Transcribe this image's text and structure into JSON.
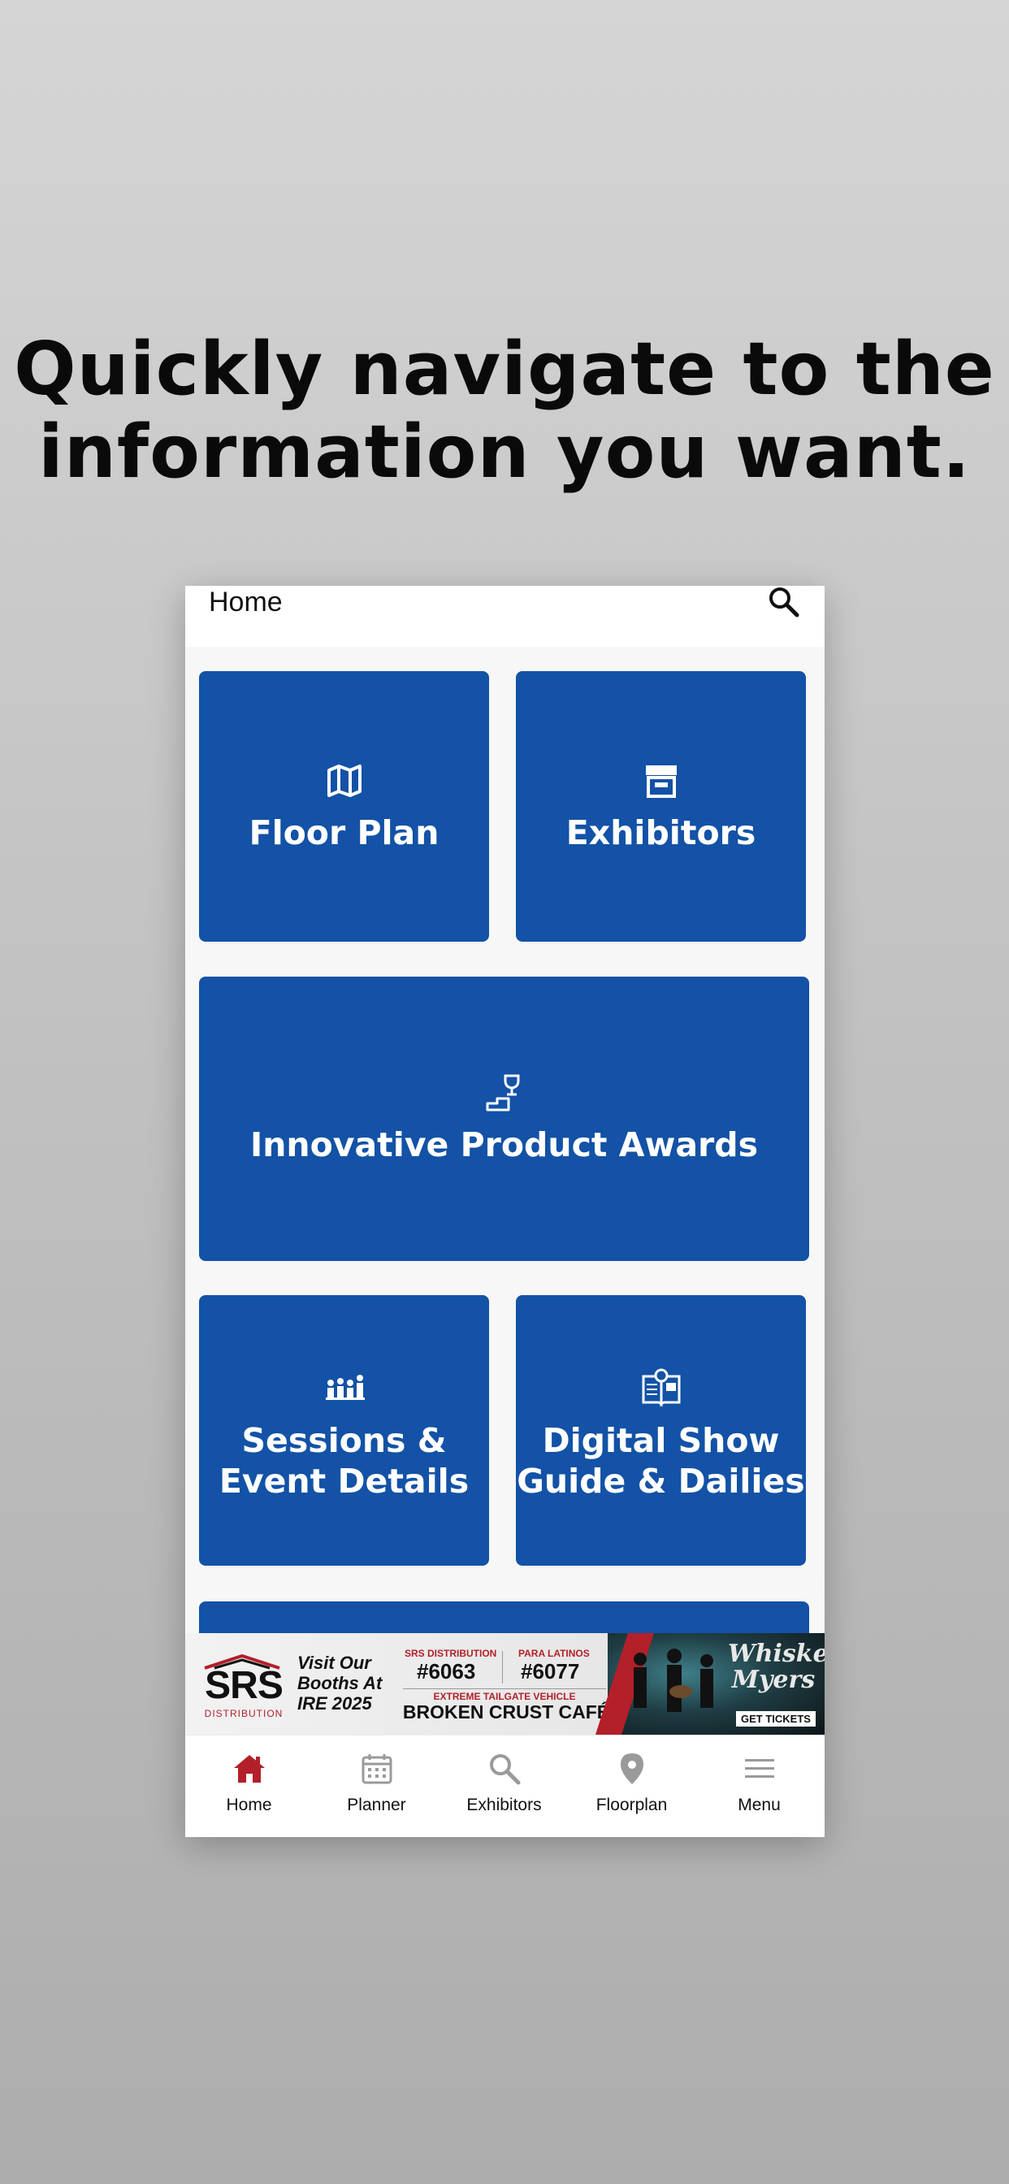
{
  "headline": {
    "line1": "Quickly navigate to the",
    "line2": "information you want."
  },
  "app": {
    "header": {
      "title": "Home",
      "search_icon": "search-icon"
    },
    "tiles": [
      {
        "label": "Floor Plan",
        "icon": "map-icon"
      },
      {
        "label": "Exhibitors",
        "icon": "storefront-icon"
      },
      {
        "label": "Innovative Product Awards",
        "icon": "trophy-podium-icon"
      },
      {
        "label": "Sessions &\nEvent Details",
        "icon": "audience-presenter-icon"
      },
      {
        "label": "Digital Show\nGuide & Dailies",
        "icon": "open-book-icon"
      }
    ],
    "banner": {
      "brand": "SRS",
      "brand_sub": "DISTRIBUTION",
      "visit_text": "Visit Our Booths At IRE 2025",
      "booth1_label": "SRS DISTRIBUTION",
      "booth1_number": "#6063",
      "booth2_label": "PARA LATINOS",
      "booth2_number": "#6077",
      "tailgate_text": "EXTREME TAILGATE VEHICLE",
      "cafe_text": "BROKEN CRUST CAFÉ",
      "band_name": "Whiskey Myers",
      "cta": "GET TICKETS",
      "accent_color": "#b3202a"
    },
    "tabbar": {
      "items": [
        {
          "label": "Home",
          "icon": "home-icon",
          "active": true
        },
        {
          "label": "Planner",
          "icon": "calendar-icon",
          "active": false
        },
        {
          "label": "Exhibitors",
          "icon": "search-icon",
          "active": false
        },
        {
          "label": "Floorplan",
          "icon": "location-pin-icon",
          "active": false
        },
        {
          "label": "Menu",
          "icon": "hamburger-menu-icon",
          "active": false
        }
      ],
      "active_color": "#b3202a",
      "inactive_color": "#9a9a9a"
    },
    "colors": {
      "tile_blue": "#1352a6",
      "background": "#f7f7f7"
    }
  }
}
